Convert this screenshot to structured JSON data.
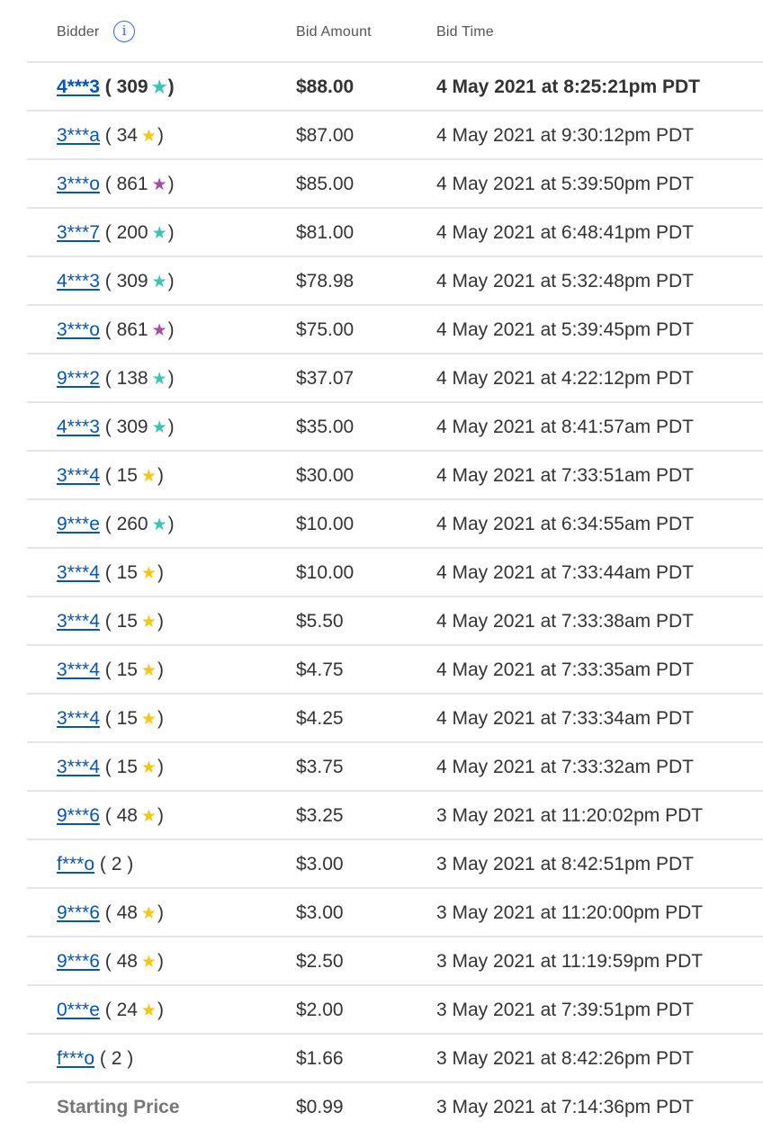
{
  "header": {
    "bidder_label": "Bidder",
    "info_icon": "i",
    "amount_label": "Bid Amount",
    "time_label": "Bid Time"
  },
  "colors": {
    "link": "#0654ba",
    "star_yellow": "#f5c518",
    "star_teal": "#3cc4b4",
    "star_purple": "#a64ca6"
  },
  "bids": [
    {
      "bidder": "4***3",
      "score": "309",
      "star": "teal",
      "amount": "$88.00",
      "time": "4 May 2021 at 8:25:21pm PDT"
    },
    {
      "bidder": "3***a",
      "score": "34",
      "star": "yellow",
      "amount": "$87.00",
      "time": "4 May 2021 at 9:30:12pm PDT"
    },
    {
      "bidder": "3***o",
      "score": "861",
      "star": "purple",
      "amount": "$85.00",
      "time": "4 May 2021 at 5:39:50pm PDT"
    },
    {
      "bidder": "3***7",
      "score": "200",
      "star": "teal",
      "amount": "$81.00",
      "time": "4 May 2021 at 6:48:41pm PDT"
    },
    {
      "bidder": "4***3",
      "score": "309",
      "star": "teal",
      "amount": "$78.98",
      "time": "4 May 2021 at 5:32:48pm PDT"
    },
    {
      "bidder": "3***o",
      "score": "861",
      "star": "purple",
      "amount": "$75.00",
      "time": "4 May 2021 at 5:39:45pm PDT"
    },
    {
      "bidder": "9***2",
      "score": "138",
      "star": "teal",
      "amount": "$37.07",
      "time": "4 May 2021 at 4:22:12pm PDT"
    },
    {
      "bidder": "4***3",
      "score": "309",
      "star": "teal",
      "amount": "$35.00",
      "time": "4 May 2021 at 8:41:57am PDT"
    },
    {
      "bidder": "3***4",
      "score": "15",
      "star": "yellow",
      "amount": "$30.00",
      "time": "4 May 2021 at 7:33:51am PDT"
    },
    {
      "bidder": "9***e",
      "score": "260",
      "star": "teal",
      "amount": "$10.00",
      "time": "4 May 2021 at 6:34:55am PDT"
    },
    {
      "bidder": "3***4",
      "score": "15",
      "star": "yellow",
      "amount": "$10.00",
      "time": "4 May 2021 at 7:33:44am PDT"
    },
    {
      "bidder": "3***4",
      "score": "15",
      "star": "yellow",
      "amount": "$5.50",
      "time": "4 May 2021 at 7:33:38am PDT"
    },
    {
      "bidder": "3***4",
      "score": "15",
      "star": "yellow",
      "amount": "$4.75",
      "time": "4 May 2021 at 7:33:35am PDT"
    },
    {
      "bidder": "3***4",
      "score": "15",
      "star": "yellow",
      "amount": "$4.25",
      "time": "4 May 2021 at 7:33:34am PDT"
    },
    {
      "bidder": "3***4",
      "score": "15",
      "star": "yellow",
      "amount": "$3.75",
      "time": "4 May 2021 at 7:33:32am PDT"
    },
    {
      "bidder": "9***6",
      "score": "48",
      "star": "yellow",
      "amount": "$3.25",
      "time": "3 May 2021 at 11:20:02pm PDT"
    },
    {
      "bidder": "f***o",
      "score": "2",
      "star": "",
      "amount": "$3.00",
      "time": "3 May 2021 at 8:42:51pm PDT"
    },
    {
      "bidder": "9***6",
      "score": "48",
      "star": "yellow",
      "amount": "$3.00",
      "time": "3 May 2021 at 11:20:00pm PDT"
    },
    {
      "bidder": "9***6",
      "score": "48",
      "star": "yellow",
      "amount": "$2.50",
      "time": "3 May 2021 at 11:19:59pm PDT"
    },
    {
      "bidder": "0***e",
      "score": "24",
      "star": "yellow",
      "amount": "$2.00",
      "time": "3 May 2021 at 7:39:51pm PDT"
    },
    {
      "bidder": "f***o",
      "score": "2",
      "star": "",
      "amount": "$1.66",
      "time": "3 May 2021 at 8:42:26pm PDT"
    }
  ],
  "starting": {
    "label": "Starting Price",
    "amount": "$0.99",
    "time": "3 May 2021 at 7:14:36pm PDT"
  }
}
